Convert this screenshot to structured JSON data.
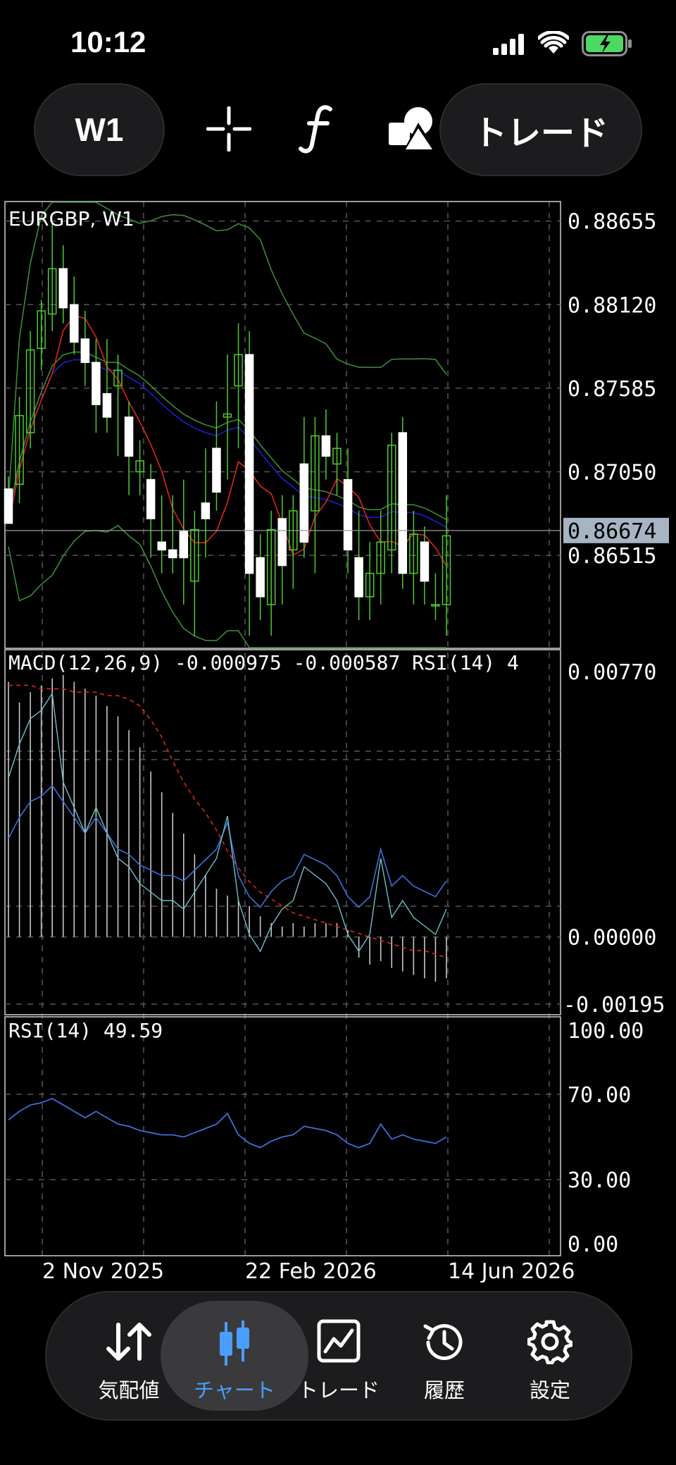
{
  "status_bar": {
    "time": "10:12"
  },
  "toolbar": {
    "timeframe_label": "W1",
    "trade_label": "トレード"
  },
  "chart": {
    "symbol_label": "EURGBP, W1",
    "macd_label": "MACD(12,26,9) -0.000975 -0.000587 RSI(14) 4",
    "rsi_label": "RSI(14) 49.59",
    "current_price": "0.86674",
    "colors": {
      "accent": "#4a9eff",
      "bull": "#ffffff",
      "wick": "#4ecb2e",
      "ma": "#e0241b",
      "ma2": "#1d1dd0",
      "band": "#3a8a3a"
    }
  },
  "chart_data": [
    {
      "type": "candlestick",
      "title": "EURGBP, W1",
      "y_ticks": [
        "0.88655",
        "0.88120",
        "0.87585",
        "0.87050",
        "0.86515"
      ],
      "ylim": [
        0.8592,
        0.8878
      ],
      "current_price": 0.86674,
      "x_ticks": [
        "2 Nov 2025",
        "22 Feb 2026",
        "14 Jun 2026"
      ],
      "ohlc": [
        [
          0.8694,
          0.8702,
          0.8672,
          0.8672
        ],
        [
          0.8697,
          0.8753,
          0.8685,
          0.8741
        ],
        [
          0.873,
          0.8795,
          0.872,
          0.8783
        ],
        [
          0.8784,
          0.8815,
          0.877,
          0.8808
        ],
        [
          0.8806,
          0.8865,
          0.8795,
          0.8835
        ],
        [
          0.8835,
          0.885,
          0.88,
          0.881
        ],
        [
          0.8812,
          0.883,
          0.878,
          0.8788
        ],
        [
          0.879,
          0.8808,
          0.876,
          0.8775
        ],
        [
          0.8775,
          0.879,
          0.873,
          0.8748
        ],
        [
          0.8755,
          0.879,
          0.873,
          0.874
        ],
        [
          0.876,
          0.878,
          0.8715,
          0.877
        ],
        [
          0.874,
          0.875,
          0.869,
          0.8715
        ],
        [
          0.8705,
          0.8725,
          0.869,
          0.8712
        ],
        [
          0.87,
          0.871,
          0.865,
          0.8675
        ],
        [
          0.866,
          0.869,
          0.864,
          0.8655
        ],
        [
          0.8655,
          0.869,
          0.864,
          0.865
        ],
        [
          0.8667,
          0.87,
          0.862,
          0.865
        ],
        [
          0.8635,
          0.868,
          0.86,
          0.8668
        ],
        [
          0.8685,
          0.872,
          0.865,
          0.8675
        ],
        [
          0.872,
          0.875,
          0.868,
          0.8692
        ],
        [
          0.874,
          0.878,
          0.87,
          0.8742
        ],
        [
          0.876,
          0.88,
          0.872,
          0.878
        ],
        [
          0.878,
          0.8795,
          0.86,
          0.864
        ],
        [
          0.865,
          0.8665,
          0.861,
          0.8625
        ],
        [
          0.862,
          0.868,
          0.86,
          0.8668
        ],
        [
          0.8675,
          0.869,
          0.862,
          0.8645
        ],
        [
          0.8655,
          0.869,
          0.863,
          0.868
        ],
        [
          0.871,
          0.874,
          0.865,
          0.866
        ],
        [
          0.868,
          0.874,
          0.864,
          0.8728
        ],
        [
          0.8728,
          0.8745,
          0.87,
          0.8715
        ],
        [
          0.871,
          0.873,
          0.869,
          0.872
        ],
        [
          0.87,
          0.872,
          0.864,
          0.8655
        ],
        [
          0.865,
          0.868,
          0.861,
          0.8625
        ],
        [
          0.8625,
          0.866,
          0.861,
          0.864
        ],
        [
          0.864,
          0.868,
          0.862,
          0.866
        ],
        [
          0.8655,
          0.873,
          0.864,
          0.8722
        ],
        [
          0.873,
          0.874,
          0.863,
          0.864
        ],
        [
          0.864,
          0.868,
          0.862,
          0.8665
        ],
        [
          0.866,
          0.867,
          0.862,
          0.8635
        ],
        [
          0.862,
          0.864,
          0.861,
          0.862
        ],
        [
          0.862,
          0.869,
          0.86,
          0.8664
        ]
      ]
    },
    {
      "type": "histogram",
      "title": "MACD(12,26,9) -0.000975 -0.000587 RSI(14) 4",
      "y_ticks": [
        "0.00770",
        "0.00000",
        "-0.00195"
      ],
      "ylim": [
        -0.00195,
        0.0077
      ],
      "values": [
        0.0074,
        0.0068,
        0.0071,
        0.0073,
        0.0075,
        0.0076,
        0.0074,
        0.0072,
        0.007,
        0.0067,
        0.0064,
        0.006,
        0.0055,
        0.0048,
        0.0042,
        0.0036,
        0.003,
        0.0024,
        0.0018,
        0.0014,
        0.0012,
        0.0011,
        0.0009,
        0.0006,
        0.0004,
        0.0003,
        0.0004,
        0.0003,
        0.0004,
        0.0004,
        0.0004,
        0.0002,
        -0.0006,
        -0.0008,
        -0.0007,
        -0.0009,
        -0.001,
        -0.0011,
        -0.0012,
        -0.0013,
        -0.0012
      ],
      "signal": [
        0.0073,
        0.0073,
        0.0073,
        0.0072,
        0.0072,
        0.0072,
        0.0071,
        0.0071,
        0.0071,
        0.007,
        0.007,
        0.0069,
        0.0067,
        0.0063,
        0.0058,
        0.0051,
        0.0045,
        0.004,
        0.0036,
        0.0031,
        0.0025,
        0.002,
        0.0016,
        0.0013,
        0.0011,
        0.0009,
        0.0007,
        0.0006,
        0.0005,
        0.0004,
        0.0003,
        0.0002,
        0.0001,
        0.0,
        -0.0001,
        -0.0002,
        -0.0003,
        -0.0004,
        -0.0004,
        -0.0005,
        -0.0006
      ]
    },
    {
      "type": "line",
      "title": "RSI(14) 49.59",
      "y_ticks": [
        "100.00",
        "70.00",
        "30.00",
        "0.00"
      ],
      "ylim": [
        0,
        100
      ],
      "levels": [
        70,
        30
      ],
      "values": [
        58,
        62,
        65,
        66,
        68,
        65,
        62,
        59,
        62,
        59,
        56,
        55,
        53,
        52,
        51,
        51,
        50,
        52,
        54,
        56,
        61,
        51,
        47,
        45,
        48,
        50,
        51,
        55,
        54,
        53,
        51,
        47,
        45,
        47,
        56,
        49,
        51,
        49,
        48,
        47,
        50
      ]
    }
  ],
  "tab_bar": {
    "items": [
      {
        "label": "気配値",
        "icon": "quotes-arrows-icon"
      },
      {
        "label": "チャート",
        "icon": "candlestick-icon",
        "active": true
      },
      {
        "label": "トレード",
        "icon": "trade-line-icon"
      },
      {
        "label": "履歴",
        "icon": "history-clock-icon"
      },
      {
        "label": "設定",
        "icon": "settings-gear-icon"
      }
    ]
  }
}
